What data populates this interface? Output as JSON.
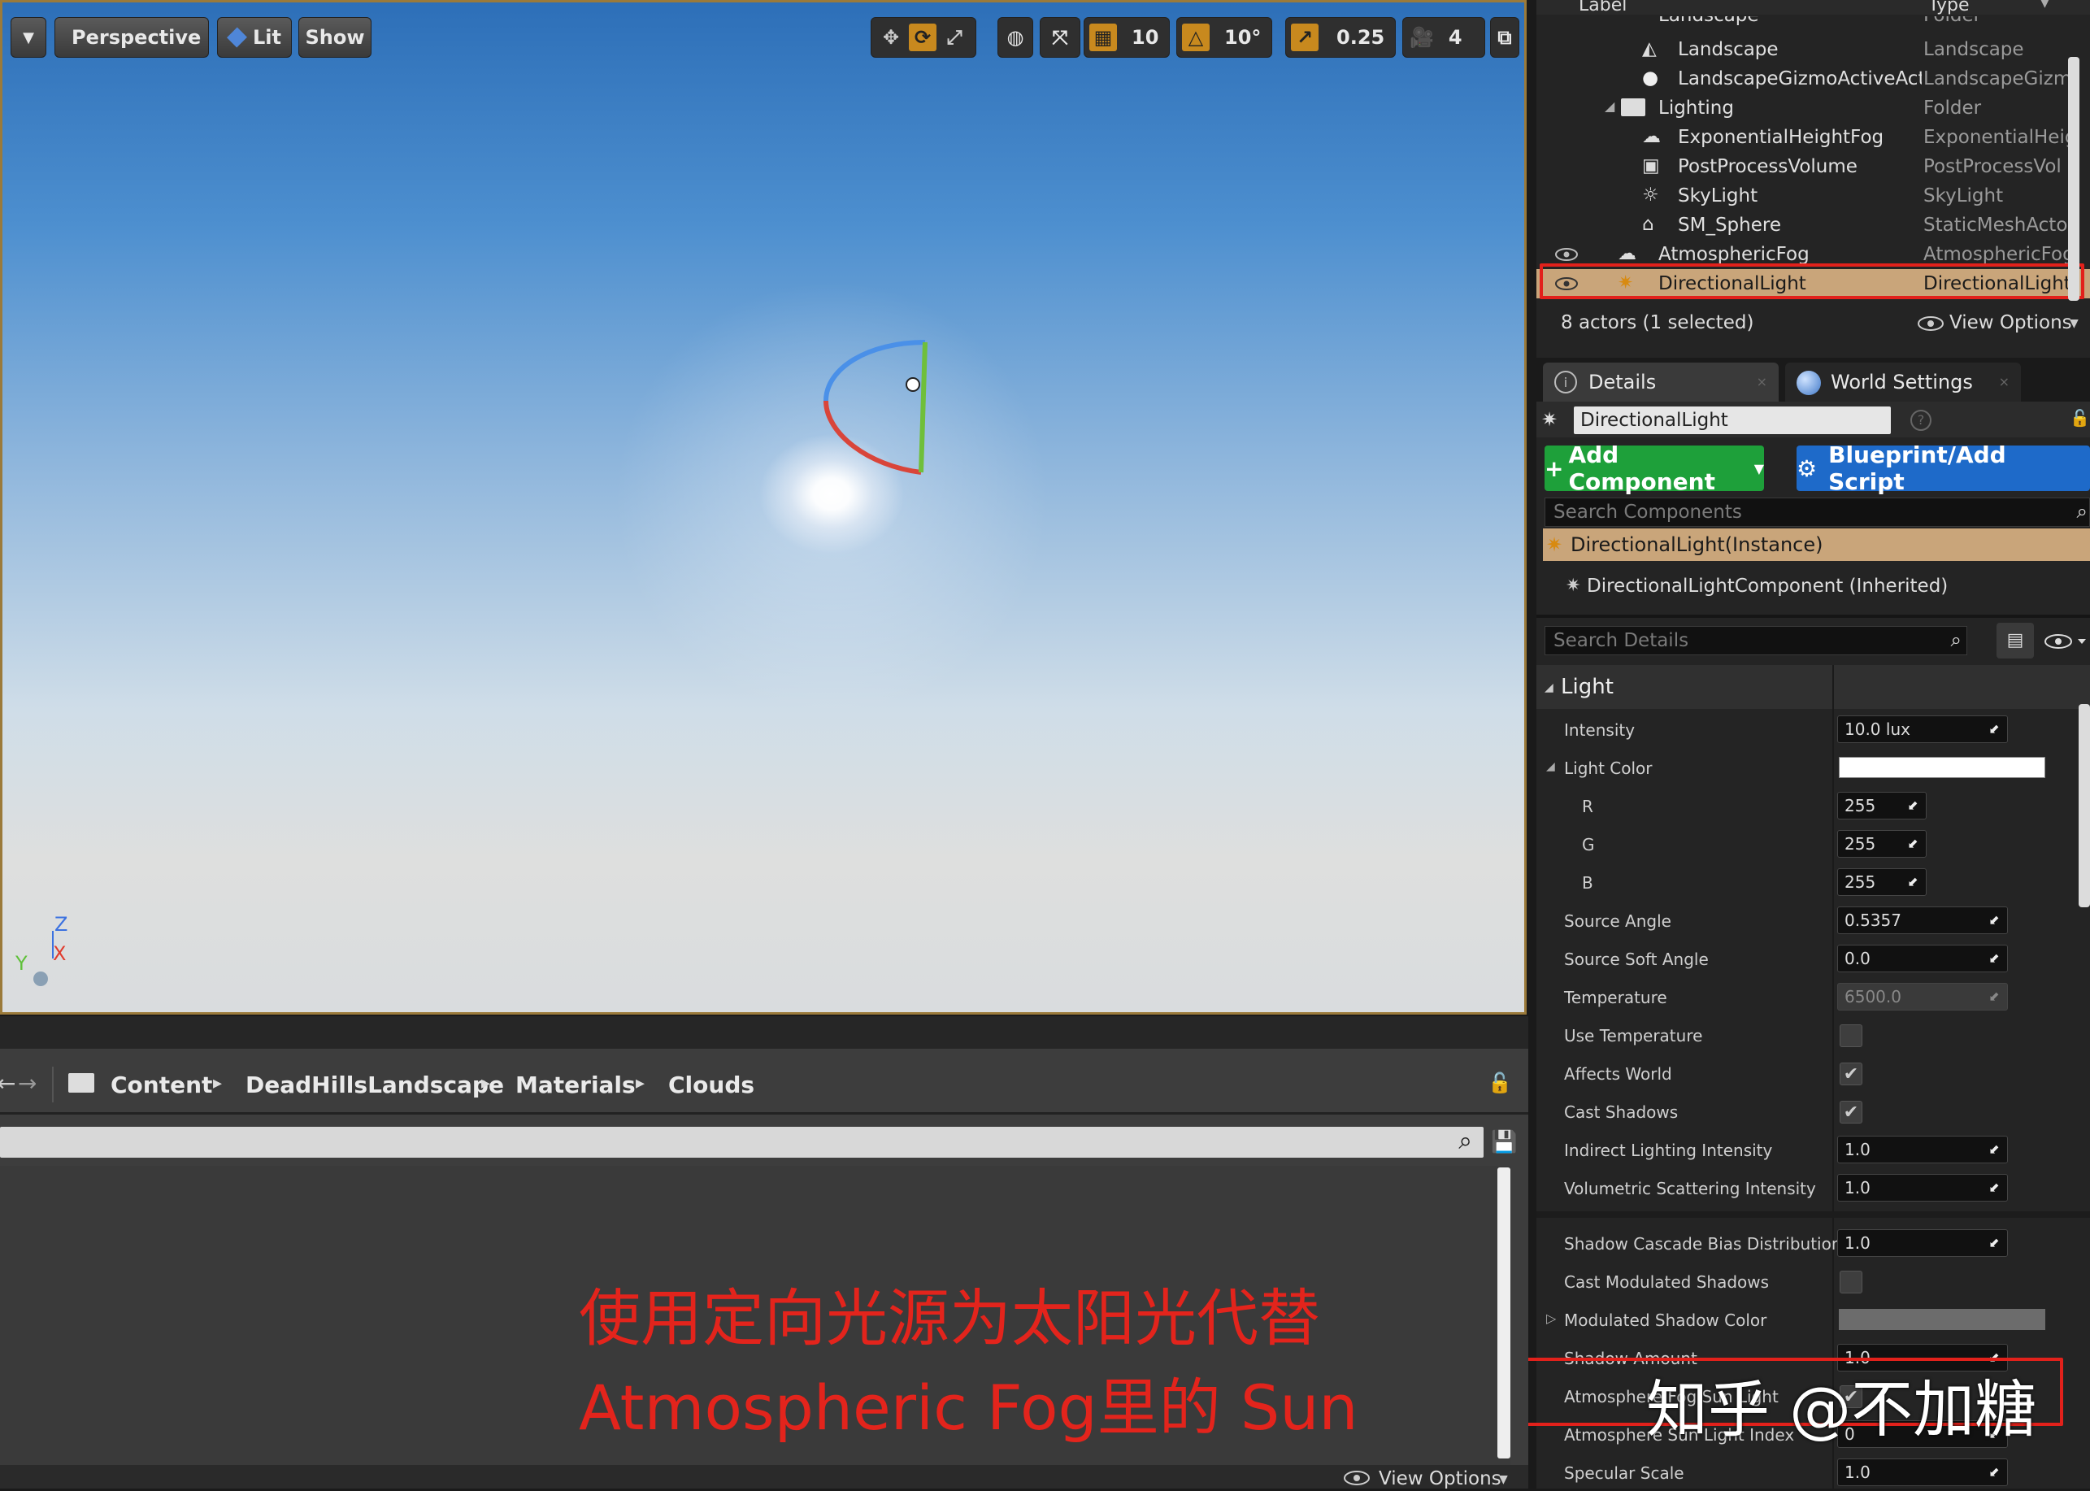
{
  "viewport": {
    "menu_label": "▼",
    "perspective_label": "Perspective",
    "lit_label": "Lit",
    "show_label": "Show",
    "grid_snap": "10",
    "rotate_snap": "10°",
    "scale_snap": "0.25",
    "camera_speed": "4",
    "axis_z": "Z",
    "axis_x": "X",
    "axis_y": "Y"
  },
  "outliner": {
    "col_label": "Label",
    "col_type": "Type",
    "rows": [
      {
        "label": "Landscape",
        "type": "Folder"
      },
      {
        "label": "Landscape",
        "type": "Landscape"
      },
      {
        "label": "LandscapeGizmoActiveActo",
        "type": "LandscapeGizm"
      },
      {
        "label": "Lighting",
        "type": "Folder"
      },
      {
        "label": "ExponentialHeightFog",
        "type": "ExponentialHeig"
      },
      {
        "label": "PostProcessVolume",
        "type": "PostProcessVol"
      },
      {
        "label": "SkyLight",
        "type": "SkyLight"
      },
      {
        "label": "SM_Sphere",
        "type": "StaticMeshActo"
      },
      {
        "label": "AtmosphericFog",
        "type": "AtmosphericFog"
      },
      {
        "label": "DirectionalLight",
        "type": "DirectionalLight"
      }
    ],
    "status": "8 actors (1 selected)",
    "view_options": "View Options"
  },
  "details": {
    "tab_details": "Details",
    "tab_world": "World Settings",
    "actor_name": "DirectionalLight",
    "add_component": "Add Component",
    "blueprint": "Blueprint/Add Script",
    "search_components": "Search Components",
    "instance": "DirectionalLight(Instance)",
    "component": "DirectionalLightComponent (Inherited)",
    "search_details": "Search Details",
    "section_light": "Light",
    "props": {
      "intensity": {
        "name": "Intensity",
        "value": "10.0 lux"
      },
      "light_color": {
        "name": "Light Color"
      },
      "r": {
        "name": "R",
        "value": "255"
      },
      "g": {
        "name": "G",
        "value": "255"
      },
      "b": {
        "name": "B",
        "value": "255"
      },
      "source_angle": {
        "name": "Source Angle",
        "value": "0.5357"
      },
      "source_soft_angle": {
        "name": "Source Soft Angle",
        "value": "0.0"
      },
      "temperature": {
        "name": "Temperature",
        "value": "6500.0"
      },
      "use_temperature": {
        "name": "Use Temperature"
      },
      "affects_world": {
        "name": "Affects World"
      },
      "cast_shadows": {
        "name": "Cast Shadows"
      },
      "indirect": {
        "name": "Indirect Lighting Intensity",
        "value": "1.0"
      },
      "volumetric": {
        "name": "Volumetric Scattering Intensity",
        "value": "1.0"
      },
      "cascade": {
        "name": "Shadow Cascade Bias Distribution",
        "value": "1.0"
      },
      "modulated": {
        "name": "Cast Modulated Shadows"
      },
      "mod_color": {
        "name": "Modulated Shadow Color"
      },
      "shadow_amount": {
        "name": "Shadow Amount",
        "value": "1.0"
      },
      "atmo_sun": {
        "name": "Atmosphere Fog Sun Light"
      },
      "atmo_index": {
        "name": "Atmosphere Sun Light Index",
        "value": "0"
      },
      "specular": {
        "name": "Specular Scale",
        "value": "1.0"
      }
    }
  },
  "content_browser": {
    "crumbs": [
      "Content",
      "DeadHillsLandscape",
      "Materials",
      "Clouds"
    ],
    "view_options": "View Options"
  },
  "annotation": {
    "line1": "使用定向光源为太阳光代替",
    "line2": "Atmospheric Fog里的 Sun",
    "watermark": "知乎 @不加糖"
  }
}
